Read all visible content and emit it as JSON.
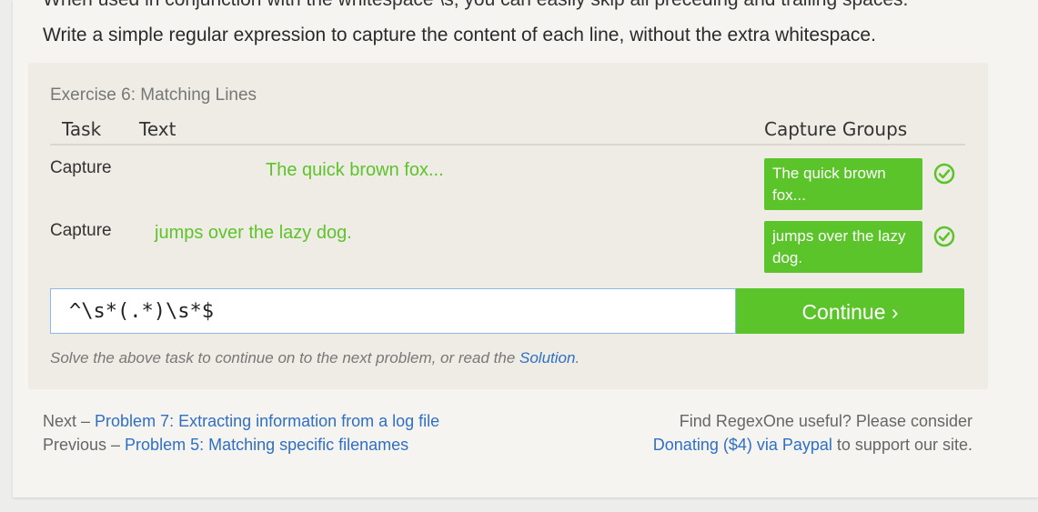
{
  "top_partial_text": "When used in conjunction with the whitespace \\s, you can easily skip all preceding and trailing spaces.",
  "intro": "Write a simple regular expression to capture the content of each line, without the extra whitespace.",
  "exercise": {
    "title": "Exercise 6: Matching Lines",
    "headers": {
      "task": "Task",
      "text": "Text",
      "groups": "Capture Groups"
    },
    "rows": [
      {
        "task": "Capture",
        "text": "The quick brown fox...",
        "group": "The quick brown fox...",
        "status": "check-icon"
      },
      {
        "task": "Capture",
        "text": "jumps over the lazy dog.",
        "group": "jumps over the lazy dog.",
        "status": "check-icon"
      }
    ],
    "regex_value": "^\\s*(.*)\\s*$",
    "continue_label": "Continue ›",
    "note_prefix": "Solve the above task to continue on to the next problem, or read the ",
    "note_link": "Solution",
    "note_suffix": "."
  },
  "nav": {
    "next_prefix": "Next – ",
    "next_link": "Problem 7: Extracting information from a log file",
    "prev_prefix": "Previous – ",
    "prev_link": "Problem 5: Matching specific filenames"
  },
  "donate": {
    "line1": "Find RegexOne useful? Please consider",
    "link": "Donating ($4) via Paypal",
    "suffix": " to support our site."
  },
  "colors": {
    "accent_green": "#5bc42a",
    "link_blue": "#2f6fc4"
  }
}
